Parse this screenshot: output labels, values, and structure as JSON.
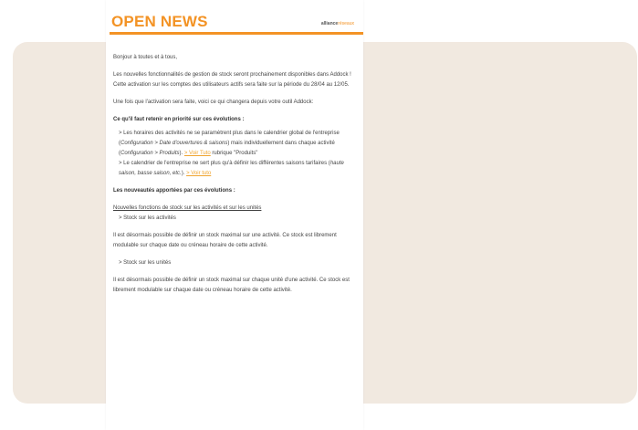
{
  "newsletter": {
    "title": "OPEN NEWS",
    "brand": "alliance",
    "brand_suffix": "réseaux",
    "accent_color": "#f39325"
  },
  "body": {
    "greeting": "Bonjour à toutes et à tous,",
    "intro_1": "Les nouvelles fonctionnalités de gestion de stock seront prochainement disponibles dans Addock !",
    "intro_2": "Cette activation sur les comptes des utilisateurs actifs sera faite sur la période du 28/04 au 12/05.",
    "intro_3": "Une fois que l'activation sera faite, voici ce qui changera depuis votre outil Addock:",
    "priority_heading": "Ce qu'il faut retenir en priorité sur ces évolutions :",
    "priority_1_a": "> Les horaires des activités ne se paramètrent plus dans le calendrier global de l'entreprise (",
    "priority_1_i1": "Configuration > Date d'ouvertures & saisons",
    "priority_1_b": ") mais individuellement dans chaque activité (",
    "priority_1_i2": "Configuration > Produits",
    "priority_1_c": "). ",
    "priority_1_link": "> Voir Tuto",
    "priority_1_d": " rubrique \"Produits\"",
    "priority_2_a": "> Le calendrier de l'entreprise ne sert plus qu'à définir les différentes saisons tarifaires (",
    "priority_2_i1": "haute saison, basse saison, etc.",
    "priority_2_b": "). ",
    "priority_2_link": "> Voir tuto",
    "news_heading": "Les nouveautés apportées par ces évolutions :",
    "news_sub": "Nouvelles fonctions de stock sur les activités et sur les unités",
    "stock_act_label": "> Stock sur les activités",
    "stock_act_text": "Il est désormais possible de définir un stock maximal sur une activité. Ce stock est librement modulable sur chaque date ou créneau horaire de cette activité.",
    "stock_unit_label": "> Stock sur les unités",
    "stock_unit_text": "Il est désormais possible de définir un stock maximal sur chaque unité d'une activité. Ce stock est librement modulable sur chaque date ou créneau horaire de cette activité."
  }
}
